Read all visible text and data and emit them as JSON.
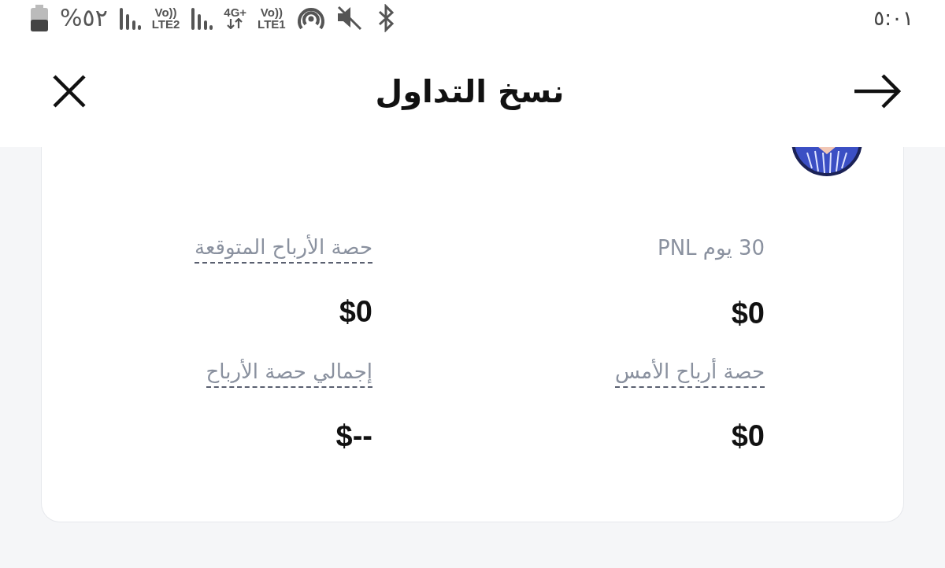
{
  "status_bar": {
    "battery_percent": "%٥٢",
    "sim2_volte": "Vo))",
    "sim2_network": "LTE2",
    "data_network": "4G+",
    "sim1_volte": "Vo))",
    "sim1_network": "LTE1",
    "time": "٥:٠١"
  },
  "header": {
    "title": "نسخ التداول"
  },
  "stats": [
    {
      "label": "30 يوم PNL",
      "underlined": false,
      "value": "$0"
    },
    {
      "label": "حصة الأرباح المتوقعة",
      "underlined": true,
      "value": "$0"
    },
    {
      "label": "حصة أرباح الأمس",
      "underlined": true,
      "value": "$0"
    },
    {
      "label": "إجمالي حصة الأرباح",
      "underlined": true,
      "value": "$--"
    }
  ]
}
